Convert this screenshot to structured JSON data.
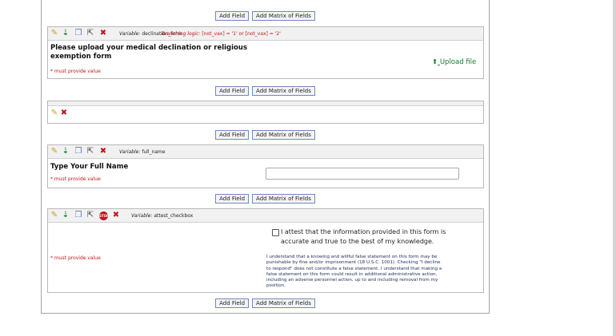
{
  "add_bar": {
    "add_field": "Add Field",
    "add_matrix": "Add Matrix of Fields"
  },
  "fields": {
    "declination": {
      "variable_prefix": "Variable:",
      "variable": "declination_form",
      "branching_prefix": "Branching logic:",
      "branching": "[not_vax] = '1' or [not_vax] = '2'",
      "label_line1": "Please upload your medical declination or religious",
      "label_line2": "exemption form",
      "required": "* must provide value",
      "upload_icon": "upload-arrow-icon",
      "upload_label": "Upload file"
    },
    "empty": {},
    "full_name": {
      "variable_prefix": "Variable:",
      "variable": "full_name",
      "label": "Type Your Full Name",
      "required": "* must provide value",
      "value": ""
    },
    "attest": {
      "variable_prefix": "Variable:",
      "variable": "attest_checkbox",
      "checkbox_line1": "I attest that the information provided in this form is",
      "checkbox_line2": "accurate and true to the best of my knowledge.",
      "required": "* must provide value",
      "legal": [
        "I understand that a knowing and willful false statement on this form may be",
        "punishable by fine and/or imprisonment (18 U.S.C. 1001). Checking \"I decline",
        "to respond\" does not constitute a false statement. I understand that making a",
        "false statement on this form could result in additional administrative action,",
        "including an adverse personnel action, up to and including removal from my",
        "position."
      ],
      "stop_icon_text": "STOP"
    }
  },
  "colors": {
    "required": "#c4141a",
    "upload": "#1a7a2e",
    "branching": "#c4141a",
    "button_border": "#6d8bbb"
  }
}
